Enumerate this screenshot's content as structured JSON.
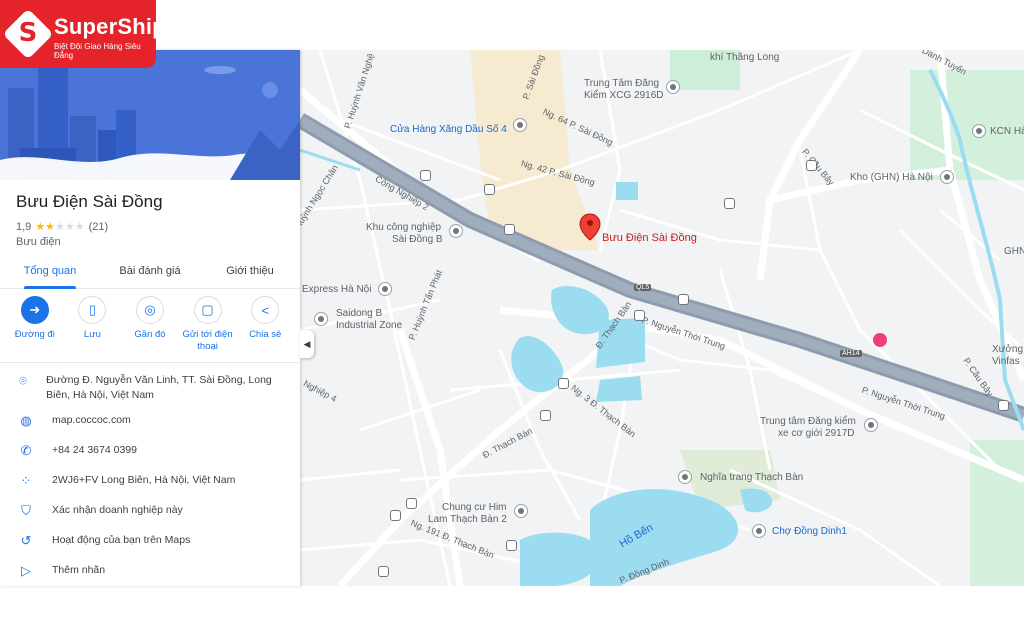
{
  "logo": {
    "name": "SuperShip",
    "tagline": "Biệt Đội Giao Hàng Siêu Đẳng",
    "mark": "S"
  },
  "place": {
    "title": "Bưu Điện Sài Đồng",
    "rating": "1,9",
    "stars": 2,
    "review_count": "(21)",
    "category": "Bưu điện"
  },
  "tabs": [
    "Tổng quan",
    "Bài đánh giá",
    "Giới thiệu"
  ],
  "actions": [
    {
      "label": "Đường đi",
      "icon": "directions-icon"
    },
    {
      "label": "Lưu",
      "icon": "bookmark-icon"
    },
    {
      "label": "Gần đó",
      "icon": "nearby-icon"
    },
    {
      "label": "Gửi tới điện thoại",
      "icon": "send-to-phone-icon"
    },
    {
      "label": "Chia sẻ",
      "icon": "share-icon"
    }
  ],
  "info": [
    {
      "icon": "location-pin-icon",
      "text": "Đường Đ. Nguyễn Văn Linh, TT. Sài Đồng, Long Biên, Hà Nội, Việt Nam"
    },
    {
      "icon": "globe-icon",
      "text": "map.coccoc.com"
    },
    {
      "icon": "phone-icon",
      "text": "+84 24 3674 0399"
    },
    {
      "icon": "plus-code-icon",
      "text": "2WJ6+FV Long Biên, Hà Nội, Việt Nam"
    },
    {
      "icon": "verified-shield-icon",
      "text": "Xác nhận doanh nghiệp này"
    },
    {
      "icon": "history-icon",
      "text": "Hoạt động của bạn trên Maps"
    },
    {
      "icon": "label-icon",
      "text": "Thêm nhãn"
    }
  ],
  "map": {
    "selected_label": "Bưu Điện Sài Đồng",
    "labels": {
      "khi_thang_long": "khí Thăng Long",
      "danh_tuyen": "Danh Tuyến",
      "p_sai_dong_top": "P. Sài Đồng",
      "trung_tam_1": "Trung Tâm Đăng",
      "trung_tam_2": "Kiểm XCG 2916D",
      "kcn_ha": "KCN Hà",
      "p_huynh_van_nghe": "P. Huỳnh Văn Nghệ",
      "cua_hang_xang": "Cửa Hàng Xăng Dầu Số 4",
      "ng64": "Ng. 64 P. Sài Đồng",
      "ng42": "Ng. 42 P. Sài Đồng",
      "p_cau_bay": "P. Cầu Bây",
      "kho_ghn": "Kho (GHN) Hà Nội",
      "cong_nghiep_2": "Công Nghiệp 2",
      "p_huynh_ngoc_chan": "P. Huỳnh Ngọc Chân",
      "kcn_sai_dong_b_1": "Khu công nghiệp",
      "kcn_sai_dong_b_2": "Sài Đồng B",
      "ghn": "GHN",
      "express_ha_noi": "Express Hà Nội",
      "ql5": "QL5",
      "saidong_b_1": "Saidong B",
      "saidong_b_2": "Industrial Zone",
      "p_huynh_tan_phat": "P. Huỳnh Tấn Phát",
      "d_thach_ban_1": "Đ. Thạch Bàn",
      "p_nguyen_thoi_trung_1": "P. Nguyễn Thời Trung",
      "ah14_a": "AH14",
      "xuong_1": "Xưởng",
      "xuong_2": "Vinfas",
      "p_cau_bay_2": "P. Cầu Bây",
      "nghiep_4": "Nghiệp 4",
      "ng3_thach_ban": "Ng. 3 Đ. Thạch Bàn",
      "p_nguyen_thoi_trung_2": "P. Nguyễn Thời Trung",
      "trung_tam_dk_1": "Trung tâm Đăng kiểm",
      "trung_tam_dk_2": "xe cơ giới 2917D",
      "d_thach_ban_2": "Đ. Thạch Bàn",
      "nghia_trang": "Nghĩa trang Thạch Bàn",
      "chung_cu_1": "Chung cư Him",
      "chung_cu_2": "Lam Thạch Bàn 2",
      "ng191": "Ng. 191 Đ. Thạch Bàn",
      "ho_ben": "Hồ Bến",
      "cho_dong_dinh": "Chợ Đồng Dinh1",
      "p_dong_dinh": "P. Đồng Dinh"
    }
  },
  "colors": {
    "accent": "#1a73e8",
    "brand": "#e4232b",
    "highway": "#8c9cae",
    "water": "#9cdcf0",
    "park": "#c6ecd3"
  }
}
